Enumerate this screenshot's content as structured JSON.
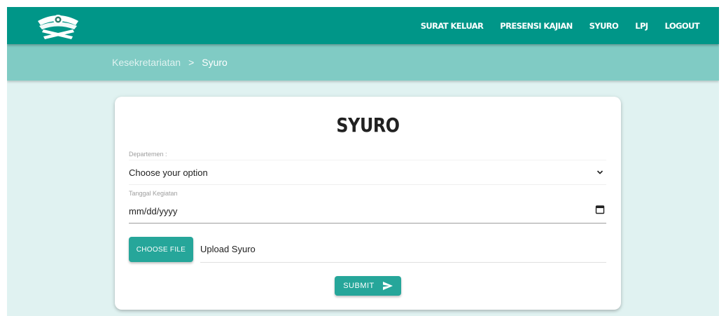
{
  "navbar": {
    "logo_icon": "quran-stand-logo-icon",
    "menu": [
      {
        "label": "SURAT KELUAR"
      },
      {
        "label": "PRESENSI KAJIAN"
      },
      {
        "label": "SYURO"
      },
      {
        "label": "LPJ"
      },
      {
        "label": "LOGOUT"
      }
    ]
  },
  "breadcrumb": {
    "parent": "Kesekretariatan",
    "separator": ">",
    "current": "Syuro"
  },
  "form": {
    "title": "SYURO",
    "departemen_label": "Departemen :",
    "departemen_value": "Choose your option",
    "tanggal_label": "Tanggal Kegiatan",
    "tanggal_value": "mm/dd/yyyy",
    "choose_file_label": "CHOOSE FILE",
    "file_placeholder": "Upload Syuro",
    "submit_label": "SUBMIT"
  },
  "colors": {
    "navbar": "#009688",
    "breadcrumb_bar": "#80cbc4",
    "page_background": "#e0f2f1",
    "button": "#26a69a"
  }
}
